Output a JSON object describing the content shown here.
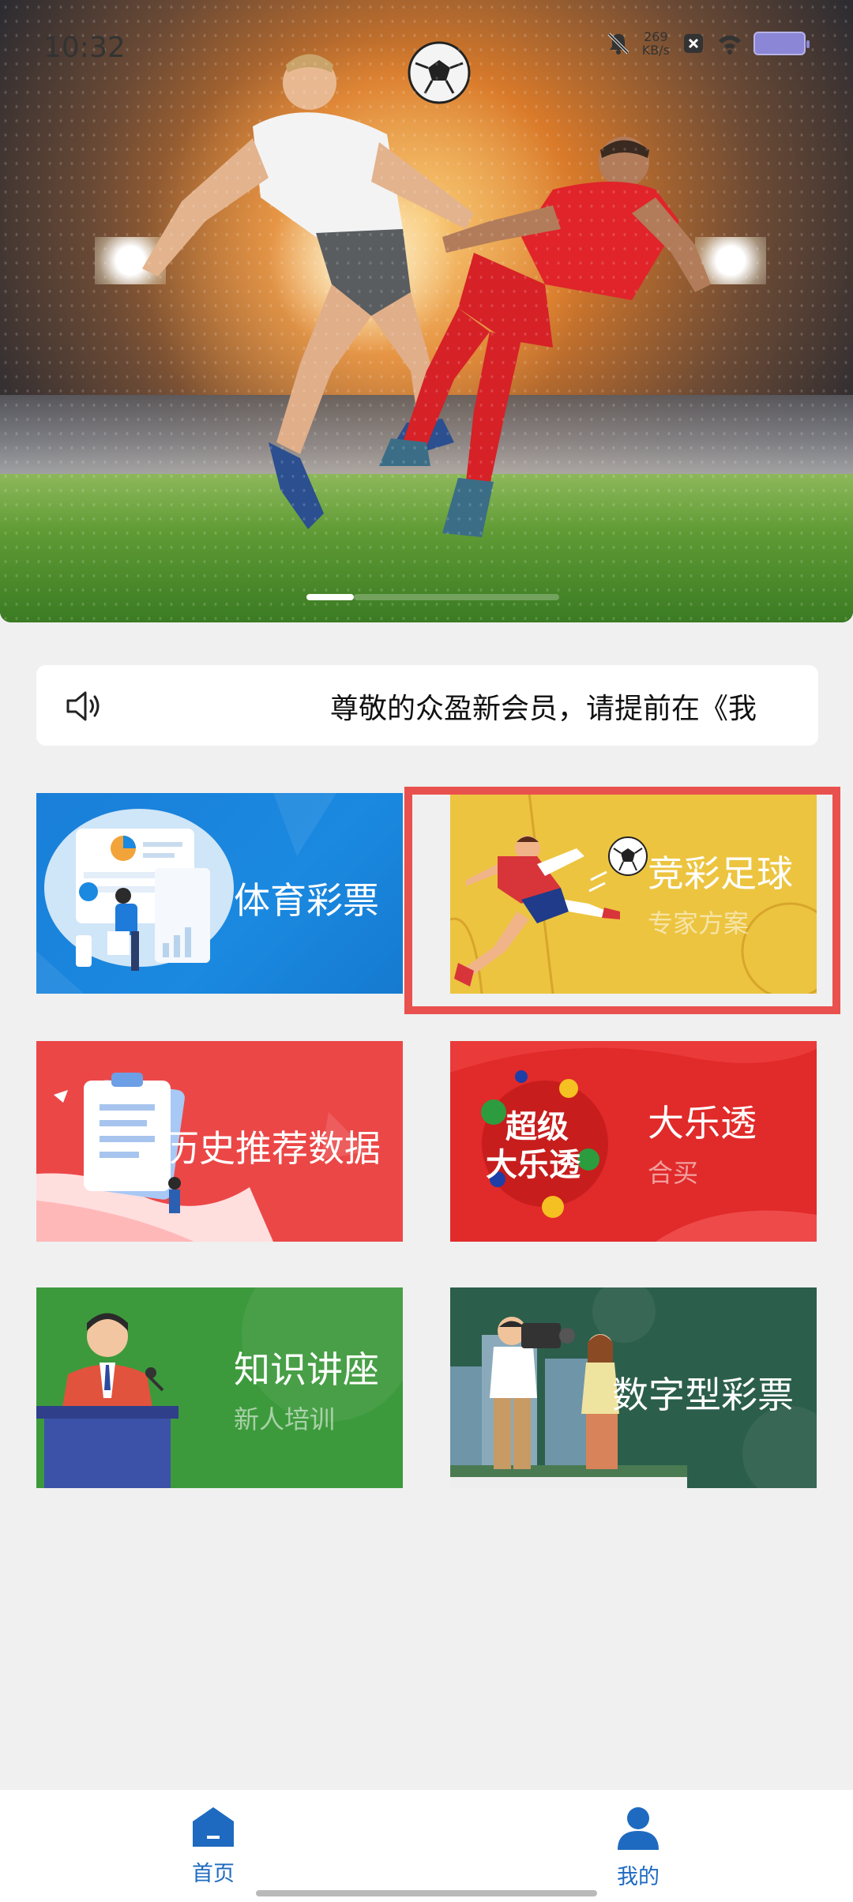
{
  "status_bar": {
    "time": "10:32",
    "speed_value": "269",
    "speed_unit": "KB/s"
  },
  "hero": {
    "pager_active_index": 0
  },
  "notice": {
    "text": "尊敬的众盈新会员，请提前在《我"
  },
  "tiles": [
    {
      "title": "体育彩票",
      "subtitle": ""
    },
    {
      "title": "竞彩足球",
      "subtitle": "专家方案"
    },
    {
      "title": "历史推荐数据",
      "subtitle": ""
    },
    {
      "title": "大乐透",
      "subtitle": "合买"
    },
    {
      "title": "知识讲座",
      "subtitle": "新人培训"
    },
    {
      "title": "数字型彩票",
      "subtitle": ""
    }
  ],
  "tile_art": {
    "dalet_logo_line1": "超级",
    "dalet_logo_line2": "大乐透"
  },
  "bottom_nav": {
    "home_label": "首页",
    "me_label": "我的",
    "active_color": "#1e6ac0"
  },
  "icons": {
    "speaker": "speaker-icon",
    "home": "home-icon",
    "user": "user-icon"
  }
}
